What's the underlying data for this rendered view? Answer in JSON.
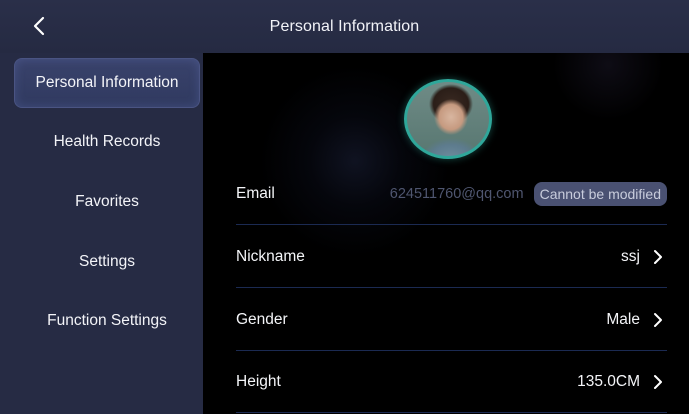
{
  "header": {
    "title": "Personal Information",
    "back_icon": "chevron-left-icon"
  },
  "sidebar": {
    "items": [
      {
        "label": "Personal Information",
        "active": true
      },
      {
        "label": "Health Records",
        "active": false
      },
      {
        "label": "Favorites",
        "active": false
      },
      {
        "label": "Settings",
        "active": false
      },
      {
        "label": "Function Settings",
        "active": false
      }
    ]
  },
  "profile": {
    "email": {
      "label": "Email",
      "value": "624511760@qq.com",
      "badge": "Cannot be modified"
    },
    "nickname": {
      "label": "Nickname",
      "value": "ssj"
    },
    "gender": {
      "label": "Gender",
      "value": "Male"
    },
    "height": {
      "label": "Height",
      "value": "135.0CM"
    }
  },
  "colors": {
    "header_bg": "#2a2f49",
    "sidebar_bg": "#262b44",
    "active_item_bg": "#39426b",
    "divider": "#1b2a52",
    "avatar_ring": "#2fa79a",
    "badge_bg": "#4a5172"
  }
}
